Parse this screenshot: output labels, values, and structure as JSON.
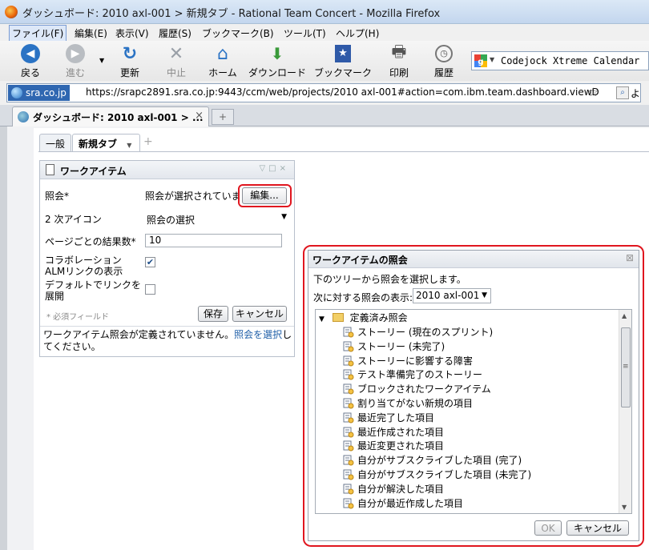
{
  "window": {
    "title": "ダッシュボード: 2010 axl-001 > 新規タブ - Rational Team Concert - Mozilla Firefox"
  },
  "menu": [
    "ファイル(F)",
    "編集(E)",
    "表示(V)",
    "履歴(S)",
    "ブックマーク(B)",
    "ツール(T)",
    "ヘルプ(H)"
  ],
  "toolbar": {
    "back": "戻る",
    "forward": "進む",
    "reload": "更新",
    "stop": "中止",
    "home": "ホーム",
    "download": "ダウンロード",
    "bookmarks": "ブックマーク",
    "print": "印刷",
    "history": "履歴",
    "search_value": "Codejock Xtreme Calendar"
  },
  "urlbar": {
    "site": "sra.co.jp",
    "url": "https://srapc2891.sra.co.jp:9443/ccm/web/projects/2010 axl-001#action=com.ibm.team.dashboard.viewD",
    "more": "よ"
  },
  "browser_tab": {
    "label": "ダッシュボード: 2010 axl-001 > ...",
    "close": "×",
    "new": "+"
  },
  "dashboard_tabs": {
    "general": "一般",
    "new_tab": "新規タブ",
    "menu_arrow": "▼",
    "add": "+"
  },
  "widget": {
    "title": "ワークアイテム",
    "query_label": "照会*",
    "query_value": "照会が選択されていま",
    "edit_button": "編集...",
    "secondary_icon_label": "2 次アイコン",
    "secondary_icon_value": "照会の選択",
    "results_label": "ページごとの結果数*",
    "results_value": "10",
    "alm_label": "コラボレーション ALMリンクの表示",
    "alm_checked": true,
    "expand_label": "デフォルトでリンクを展開",
    "expand_checked": false,
    "required_note": "* 必須フィールド",
    "save_button": "保存",
    "cancel_button": "キャンセル",
    "message_prefix": "ワークアイテム照会が定義されていません。",
    "message_link": "照会を選択",
    "message_suffix": "してください。"
  },
  "dialog": {
    "title": "ワークアイテムの照会",
    "instruction": "下のツリーから照会を選択します。",
    "project_label": "次に対する照会の表示:",
    "project_value": "2010 axl-001",
    "root": "定義済み照会",
    "items": [
      "ストーリー (現在のスプリント)",
      "ストーリー (未完了)",
      "ストーリーに影響する障害",
      "テスト準備完了のストーリー",
      "ブロックされたワークアイテム",
      "割り当てがない新規の項目",
      "最近完了した項目",
      "最近作成された項目",
      "最近変更された項目",
      "自分がサブスクライブした項目 (完了)",
      "自分がサブスクライブした項目 (未完了)",
      "自分が解決した項目",
      "自分が最近作成した項目"
    ],
    "ok_button": "OK",
    "cancel_button": "キャンセル"
  },
  "colors": {
    "highlight_ring": "#e0161f",
    "link": "#1f5fa8",
    "accent": "#2f67b1"
  }
}
